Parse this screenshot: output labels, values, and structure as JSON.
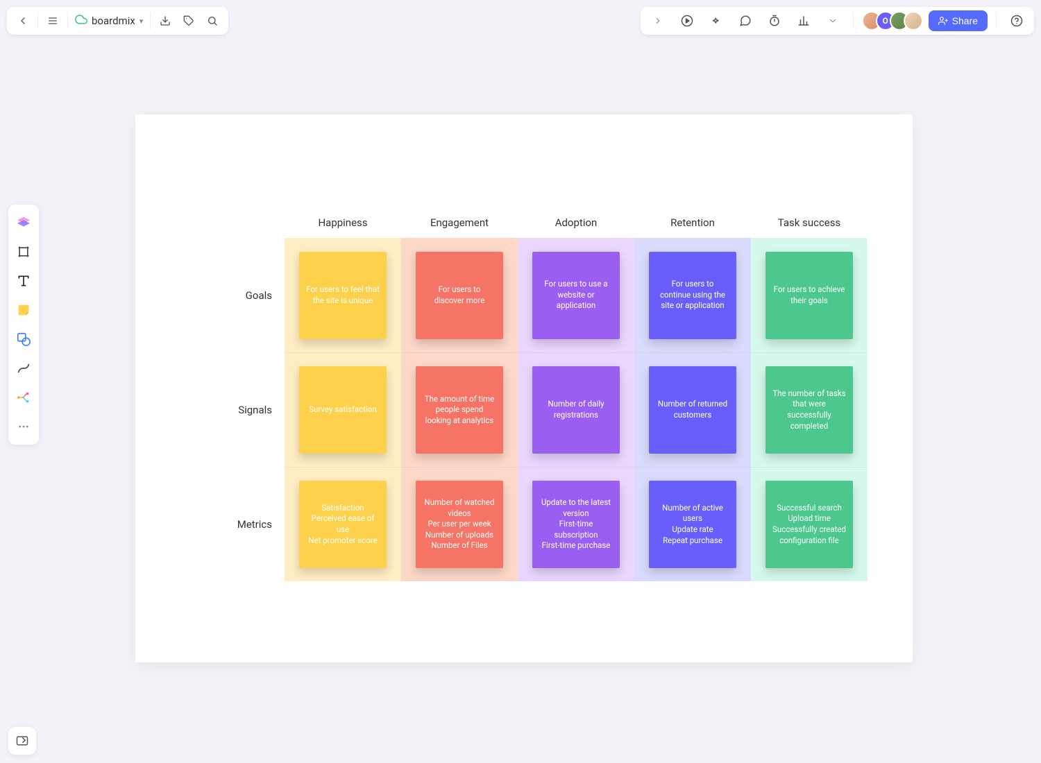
{
  "header": {
    "title": "boardmix",
    "share_label": "Share"
  },
  "avatars": [
    {
      "bg": "linear-gradient(135deg,#f0b48a,#d98e6f)",
      "text": ""
    },
    {
      "bg": "#6a5efa",
      "text": "O"
    },
    {
      "bg": "linear-gradient(135deg,#7aa262,#5c7f46)",
      "text": ""
    },
    {
      "bg": "linear-gradient(135deg,#f1d6b8,#d6b08e)",
      "text": ""
    }
  ],
  "matrix": {
    "columns": [
      "Happiness",
      "Engagement",
      "Adoption",
      "Retention",
      "Task success"
    ],
    "rows": [
      "Goals",
      "Signals",
      "Metrics"
    ],
    "cells": [
      [
        "For users to feel that the site is unique",
        "For users to discover more",
        "For users to use a website or application",
        "For users to continue using the site or application",
        "For users to achieve their goals"
      ],
      [
        "Survey satisfaction",
        "The amount of time people spend looking at analytics",
        "Number of daily registrations",
        "Number of returned customers",
        "The number of tasks that were successfully completed"
      ],
      [
        "Satisfaction\nPerceived ease of use\nNet promoter score",
        "Number of watched videos\nPer user per week\nNumber of uploads\nNumber of Files",
        "Update to the latest version\nFirst-time subscription\nFirst-time purchase",
        "Number of active users\nUpdate rate\nRepeat purchase",
        "Successful search\nUpload time\nSuccessfully created configuration file"
      ]
    ]
  }
}
